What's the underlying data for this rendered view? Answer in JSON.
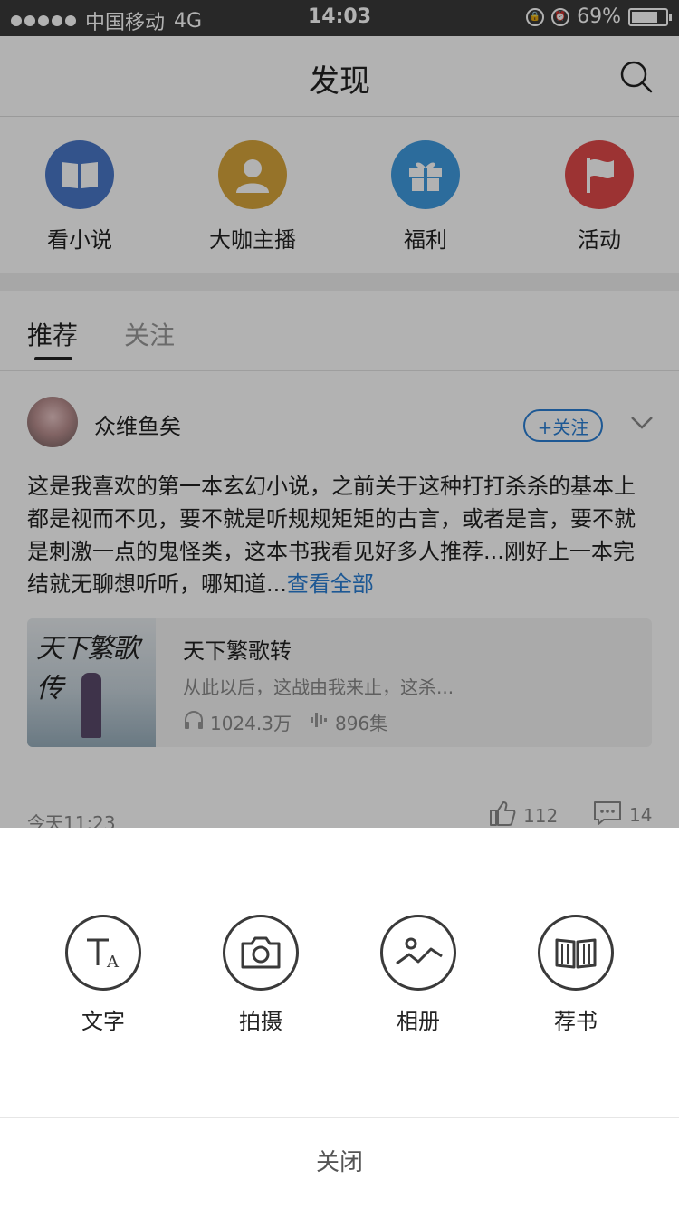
{
  "status_bar": {
    "carrier": "中国移动",
    "network": "4G",
    "time": "14:03",
    "battery": "69%"
  },
  "header": {
    "title": "发现"
  },
  "quick_entries": [
    {
      "label": "看小说",
      "color": "#4a78c8",
      "icon": "book-icon"
    },
    {
      "label": "大咖主播",
      "color": "#d7a53c",
      "icon": "user-icon"
    },
    {
      "label": "福利",
      "color": "#3f9be0",
      "icon": "gift-icon"
    },
    {
      "label": "活动",
      "color": "#e04a4a",
      "icon": "flag-icon"
    }
  ],
  "tabs": {
    "recommend": "推荐",
    "follow": "关注"
  },
  "post": {
    "author": "众维鱼矣",
    "follow_label": "+关注",
    "text": "这是我喜欢的第一本玄幻小说，之前关于这种打打杀杀的基本上都是视而不见，要不就是听规规矩矩的古言，或者是言，要不就是刺激一点的鬼怪类，这本书我看见好多人推荐...刚好上一本完结就无聊想听听，哪知道...",
    "more_label": "查看全部",
    "book": {
      "title": "天下繁歌转",
      "desc": "从此以后，这战由我来止，这杀...",
      "plays": "1024.3万",
      "episodes": "896集",
      "cover_text": "天下繁歌传"
    },
    "time": "今天11:23",
    "likes": "112",
    "comments": "14"
  },
  "share_sheet": {
    "actions": [
      {
        "label": "文字",
        "icon": "text-icon"
      },
      {
        "label": "拍摄",
        "icon": "camera-icon"
      },
      {
        "label": "相册",
        "icon": "photo-album-icon"
      },
      {
        "label": "荐书",
        "icon": "recommend-book-icon"
      }
    ],
    "close_label": "关闭"
  }
}
